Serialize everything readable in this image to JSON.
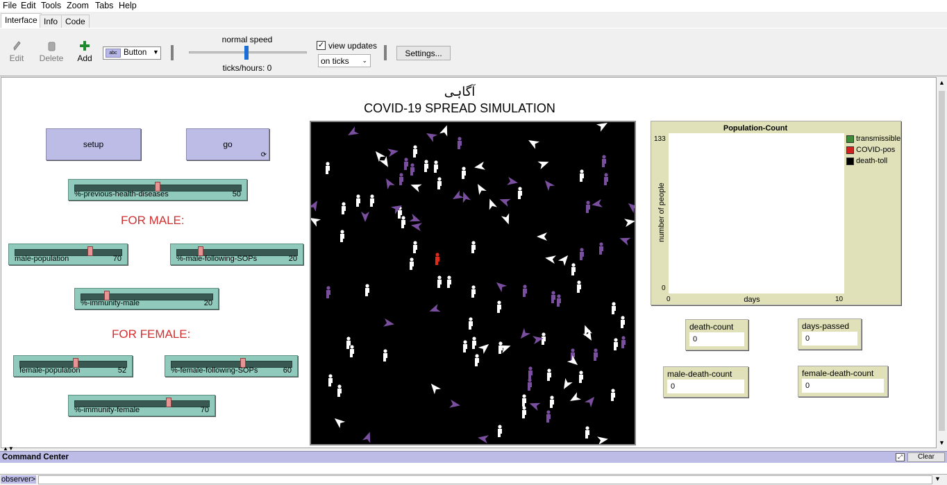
{
  "menu": [
    "File",
    "Edit",
    "Tools",
    "Zoom",
    "Tabs",
    "Help"
  ],
  "tabs": [
    "Interface",
    "Info",
    "Code"
  ],
  "toolbar": {
    "edit": "Edit",
    "delete": "Delete",
    "add": "Add",
    "widget_type": "Button",
    "speed_label": "normal speed",
    "ticks": "ticks/hours: 0",
    "view_updates": "view updates",
    "update_mode": "on ticks",
    "settings": "Settings..."
  },
  "title_farsi": "آگاہی",
  "title": "COVID-19 SPREAD SIMULATION",
  "buttons": {
    "setup": "setup",
    "go": "go"
  },
  "sliders": [
    {
      "label": "%-previous-health-diseases",
      "value": "50",
      "fraction": 0.5
    },
    {
      "label": "male-population",
      "value": "70",
      "fraction": 0.7
    },
    {
      "label": "%-male-following-SOPs",
      "value": "20",
      "fraction": 0.2
    },
    {
      "label": "%-immunity-male",
      "value": "20",
      "fraction": 0.2
    },
    {
      "label": "female-population",
      "value": "52",
      "fraction": 0.52
    },
    {
      "label": "%-female-following-SOPs",
      "value": "60",
      "fraction": 0.6
    },
    {
      "label": "%-immunity-female",
      "value": "70",
      "fraction": 0.7
    }
  ],
  "notes": {
    "male": "FOR MALE:",
    "female": "FOR FEMALE:"
  },
  "plot": {
    "title": "Population-Count",
    "ylabel": "number of people",
    "xlabel": "days",
    "ymax": "133",
    "ymin": "0",
    "xmin": "0",
    "xmax": "10",
    "legend": [
      {
        "name": "transmissible",
        "color": "#3c8c3c"
      },
      {
        "name": "COVID-pos",
        "color": "#d02020"
      },
      {
        "name": "death-toll",
        "color": "#000000"
      }
    ]
  },
  "monitors": [
    {
      "label": "death-count",
      "value": "0"
    },
    {
      "label": "days-passed",
      "value": "0"
    },
    {
      "label": "male-death-count",
      "value": "0"
    },
    {
      "label": "female-death-count",
      "value": "0"
    }
  ],
  "command_center": {
    "title": "Command Center",
    "clear": "Clear",
    "prompt": "observer>"
  }
}
